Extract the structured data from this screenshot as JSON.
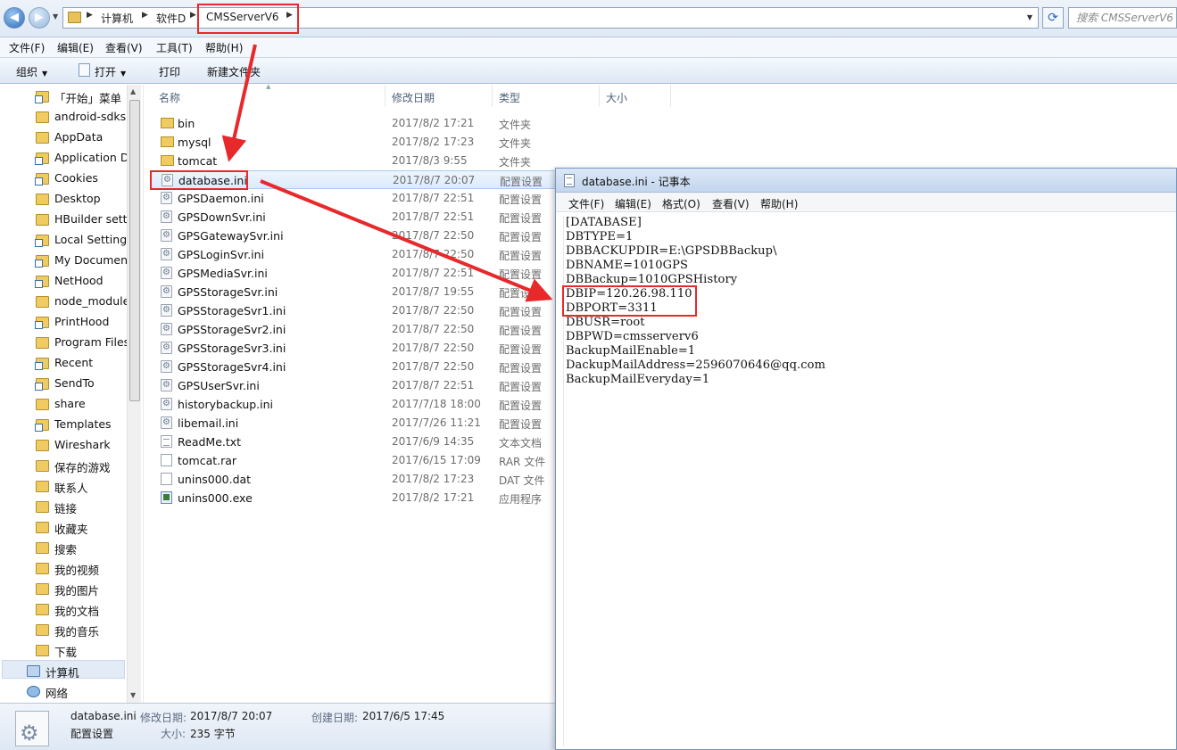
{
  "address_bar": {
    "breadcrumbs": [
      "计算机",
      "软件D",
      "CMSServerV6"
    ],
    "search_placeholder": "搜索 CMSServerV6"
  },
  "menu": [
    "文件(F)",
    "编辑(E)",
    "查看(V)",
    "工具(T)",
    "帮助(H)"
  ],
  "toolbar": {
    "organize": "组织",
    "open": "打开",
    "print": "打印",
    "new_folder": "新建文件夹"
  },
  "nav_pane": {
    "items": [
      {
        "label": "「开始」菜单",
        "icon": "folder-shortcut-icon"
      },
      {
        "label": "android-sdks",
        "icon": "folder-icon"
      },
      {
        "label": "AppData",
        "icon": "folder-icon"
      },
      {
        "label": "Application D",
        "icon": "folder-shortcut-icon"
      },
      {
        "label": "Cookies",
        "icon": "folder-shortcut-icon"
      },
      {
        "label": "Desktop",
        "icon": "folder-icon"
      },
      {
        "label": "HBuilder setti",
        "icon": "folder-icon"
      },
      {
        "label": "Local Settings",
        "icon": "folder-shortcut-icon"
      },
      {
        "label": "My Document",
        "icon": "folder-shortcut-icon"
      },
      {
        "label": "NetHood",
        "icon": "folder-shortcut-icon"
      },
      {
        "label": "node_module",
        "icon": "folder-icon"
      },
      {
        "label": "PrintHood",
        "icon": "folder-shortcut-icon"
      },
      {
        "label": "Program Files",
        "icon": "folder-icon"
      },
      {
        "label": "Recent",
        "icon": "folder-shortcut-icon"
      },
      {
        "label": "SendTo",
        "icon": "folder-shortcut-icon"
      },
      {
        "label": "share",
        "icon": "folder-icon"
      },
      {
        "label": "Templates",
        "icon": "folder-shortcut-icon"
      },
      {
        "label": "Wireshark",
        "icon": "folder-icon"
      },
      {
        "label": "保存的游戏",
        "icon": "folder-icon"
      },
      {
        "label": "联系人",
        "icon": "folder-icon"
      },
      {
        "label": "链接",
        "icon": "folder-icon"
      },
      {
        "label": "收藏夹",
        "icon": "folder-icon"
      },
      {
        "label": "搜索",
        "icon": "folder-icon"
      },
      {
        "label": "我的视频",
        "icon": "folder-icon"
      },
      {
        "label": "我的图片",
        "icon": "folder-icon"
      },
      {
        "label": "我的文档",
        "icon": "folder-icon"
      },
      {
        "label": "我的音乐",
        "icon": "folder-icon"
      },
      {
        "label": "下载",
        "icon": "folder-icon"
      }
    ],
    "computer": "计算机",
    "network": "网络"
  },
  "file_list": {
    "columns": [
      "名称",
      "修改日期",
      "类型",
      "大小"
    ],
    "rows": [
      {
        "name": "bin",
        "date": "2017/8/2 17:21",
        "type": "文件夹",
        "icon": "folder"
      },
      {
        "name": "mysql",
        "date": "2017/8/2 17:23",
        "type": "文件夹",
        "icon": "folder"
      },
      {
        "name": "tomcat",
        "date": "2017/8/3 9:55",
        "type": "文件夹",
        "icon": "folder"
      },
      {
        "name": "database.ini",
        "date": "2017/8/7 20:07",
        "type": "配置设置",
        "icon": "ini",
        "selected": true
      },
      {
        "name": "GPSDaemon.ini",
        "date": "2017/8/7 22:51",
        "type": "配置设置",
        "icon": "ini"
      },
      {
        "name": "GPSDownSvr.ini",
        "date": "2017/8/7 22:51",
        "type": "配置设置",
        "icon": "ini"
      },
      {
        "name": "GPSGatewaySvr.ini",
        "date": "2017/8/7 22:50",
        "type": "配置设置",
        "icon": "ini"
      },
      {
        "name": "GPSLoginSvr.ini",
        "date": "2017/8/7 22:50",
        "type": "配置设置",
        "icon": "ini"
      },
      {
        "name": "GPSMediaSvr.ini",
        "date": "2017/8/7 22:51",
        "type": "配置设置",
        "icon": "ini"
      },
      {
        "name": "GPSStorageSvr.ini",
        "date": "2017/8/7 19:55",
        "type": "配置设置",
        "icon": "ini"
      },
      {
        "name": "GPSStorageSvr1.ini",
        "date": "2017/8/7 22:50",
        "type": "配置设置",
        "icon": "ini"
      },
      {
        "name": "GPSStorageSvr2.ini",
        "date": "2017/8/7 22:50",
        "type": "配置设置",
        "icon": "ini"
      },
      {
        "name": "GPSStorageSvr3.ini",
        "date": "2017/8/7 22:50",
        "type": "配置设置",
        "icon": "ini"
      },
      {
        "name": "GPSStorageSvr4.ini",
        "date": "2017/8/7 22:50",
        "type": "配置设置",
        "icon": "ini"
      },
      {
        "name": "GPSUserSvr.ini",
        "date": "2017/8/7 22:51",
        "type": "配置设置",
        "icon": "ini"
      },
      {
        "name": "historybackup.ini",
        "date": "2017/7/18 18:00",
        "type": "配置设置",
        "icon": "ini"
      },
      {
        "name": "libemail.ini",
        "date": "2017/7/26 11:21",
        "type": "配置设置",
        "icon": "ini"
      },
      {
        "name": "ReadMe.txt",
        "date": "2017/6/9 14:35",
        "type": "文本文档",
        "icon": "txt"
      },
      {
        "name": "tomcat.rar",
        "date": "2017/6/15 17:09",
        "type": "RAR 文件",
        "icon": "rar"
      },
      {
        "name": "unins000.dat",
        "date": "2017/8/2 17:23",
        "type": "DAT 文件",
        "icon": "dat"
      },
      {
        "name": "unins000.exe",
        "date": "2017/8/2 17:21",
        "type": "应用程序",
        "icon": "exe"
      }
    ]
  },
  "details": {
    "filename": "database.ini",
    "type": "配置设置",
    "modified_key": "修改日期:",
    "modified_value": "2017/8/7 20:07",
    "created_key": "创建日期:",
    "created_value": "2017/6/5 17:45",
    "size_key": "大小:",
    "size_value": "235 字节"
  },
  "notepad": {
    "title": "database.ini - 记事本",
    "menu": [
      "文件(F)",
      "编辑(E)",
      "格式(O)",
      "查看(V)",
      "帮助(H)"
    ],
    "lines": [
      "[DATABASE]",
      "DBTYPE=1",
      "DBBACKUPDIR=E:\\GPSDBBackup\\",
      "DBNAME=1010GPS",
      "DBBackup=1010GPSHistory",
      "DBIP=120.26.98.110",
      "DBPORT=3311",
      "DBUSR=root",
      "DBPWD=cmsserverv6",
      "BackupMailEnable=1",
      "DackupMailAddress=2596070646@qq.com",
      "BackupMailEveryday=1"
    ]
  },
  "colors": {
    "highlight": "#e8292b",
    "selection": "#dcebfc",
    "titlebar": "#c3d6ee"
  }
}
